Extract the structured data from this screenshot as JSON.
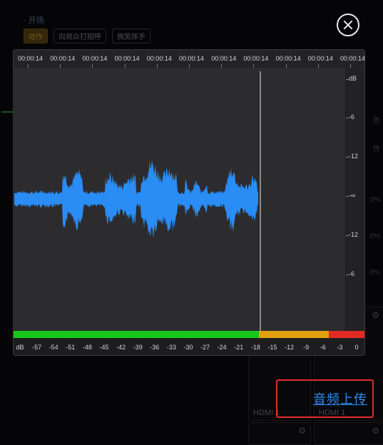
{
  "background": {
    "section_title": "开场",
    "tags": [
      "动作",
      "向观众打招呼",
      "微笑挥手"
    ],
    "right_labels": [
      "色",
      "传",
      "0%",
      "0%",
      "0%"
    ],
    "panels": [
      "HDMI 1",
      "HDMI 1"
    ]
  },
  "dialog": {
    "timeline_labels": [
      "00:00:14",
      "00:00:14",
      "00:00:14",
      "00:00:14",
      "00:00:14",
      "00:00:14",
      "00:00:14",
      "00:00:14",
      "00:00:14",
      "00:00:14",
      "00:00:14"
    ],
    "db_scale": [
      "dB",
      "-6",
      "-12",
      "-∞",
      "-12",
      "-6"
    ],
    "db_axis": [
      "dB",
      "-57",
      "-54",
      "-51",
      "-48",
      "-45",
      "-42",
      "-39",
      "-36",
      "-33",
      "-30",
      "-27",
      "-24",
      "-21",
      "-18",
      "-15",
      "-12",
      "-9",
      "-6",
      "-3",
      "0"
    ],
    "meter": {
      "level_fraction": 0.7,
      "colors": {
        "green": "#16c71a",
        "orange": "#e0a010",
        "red": "#e22a24"
      }
    },
    "waveform_color": "#2a8cf5",
    "close_icon": "close-icon"
  },
  "upload": {
    "label": "音频上传"
  }
}
